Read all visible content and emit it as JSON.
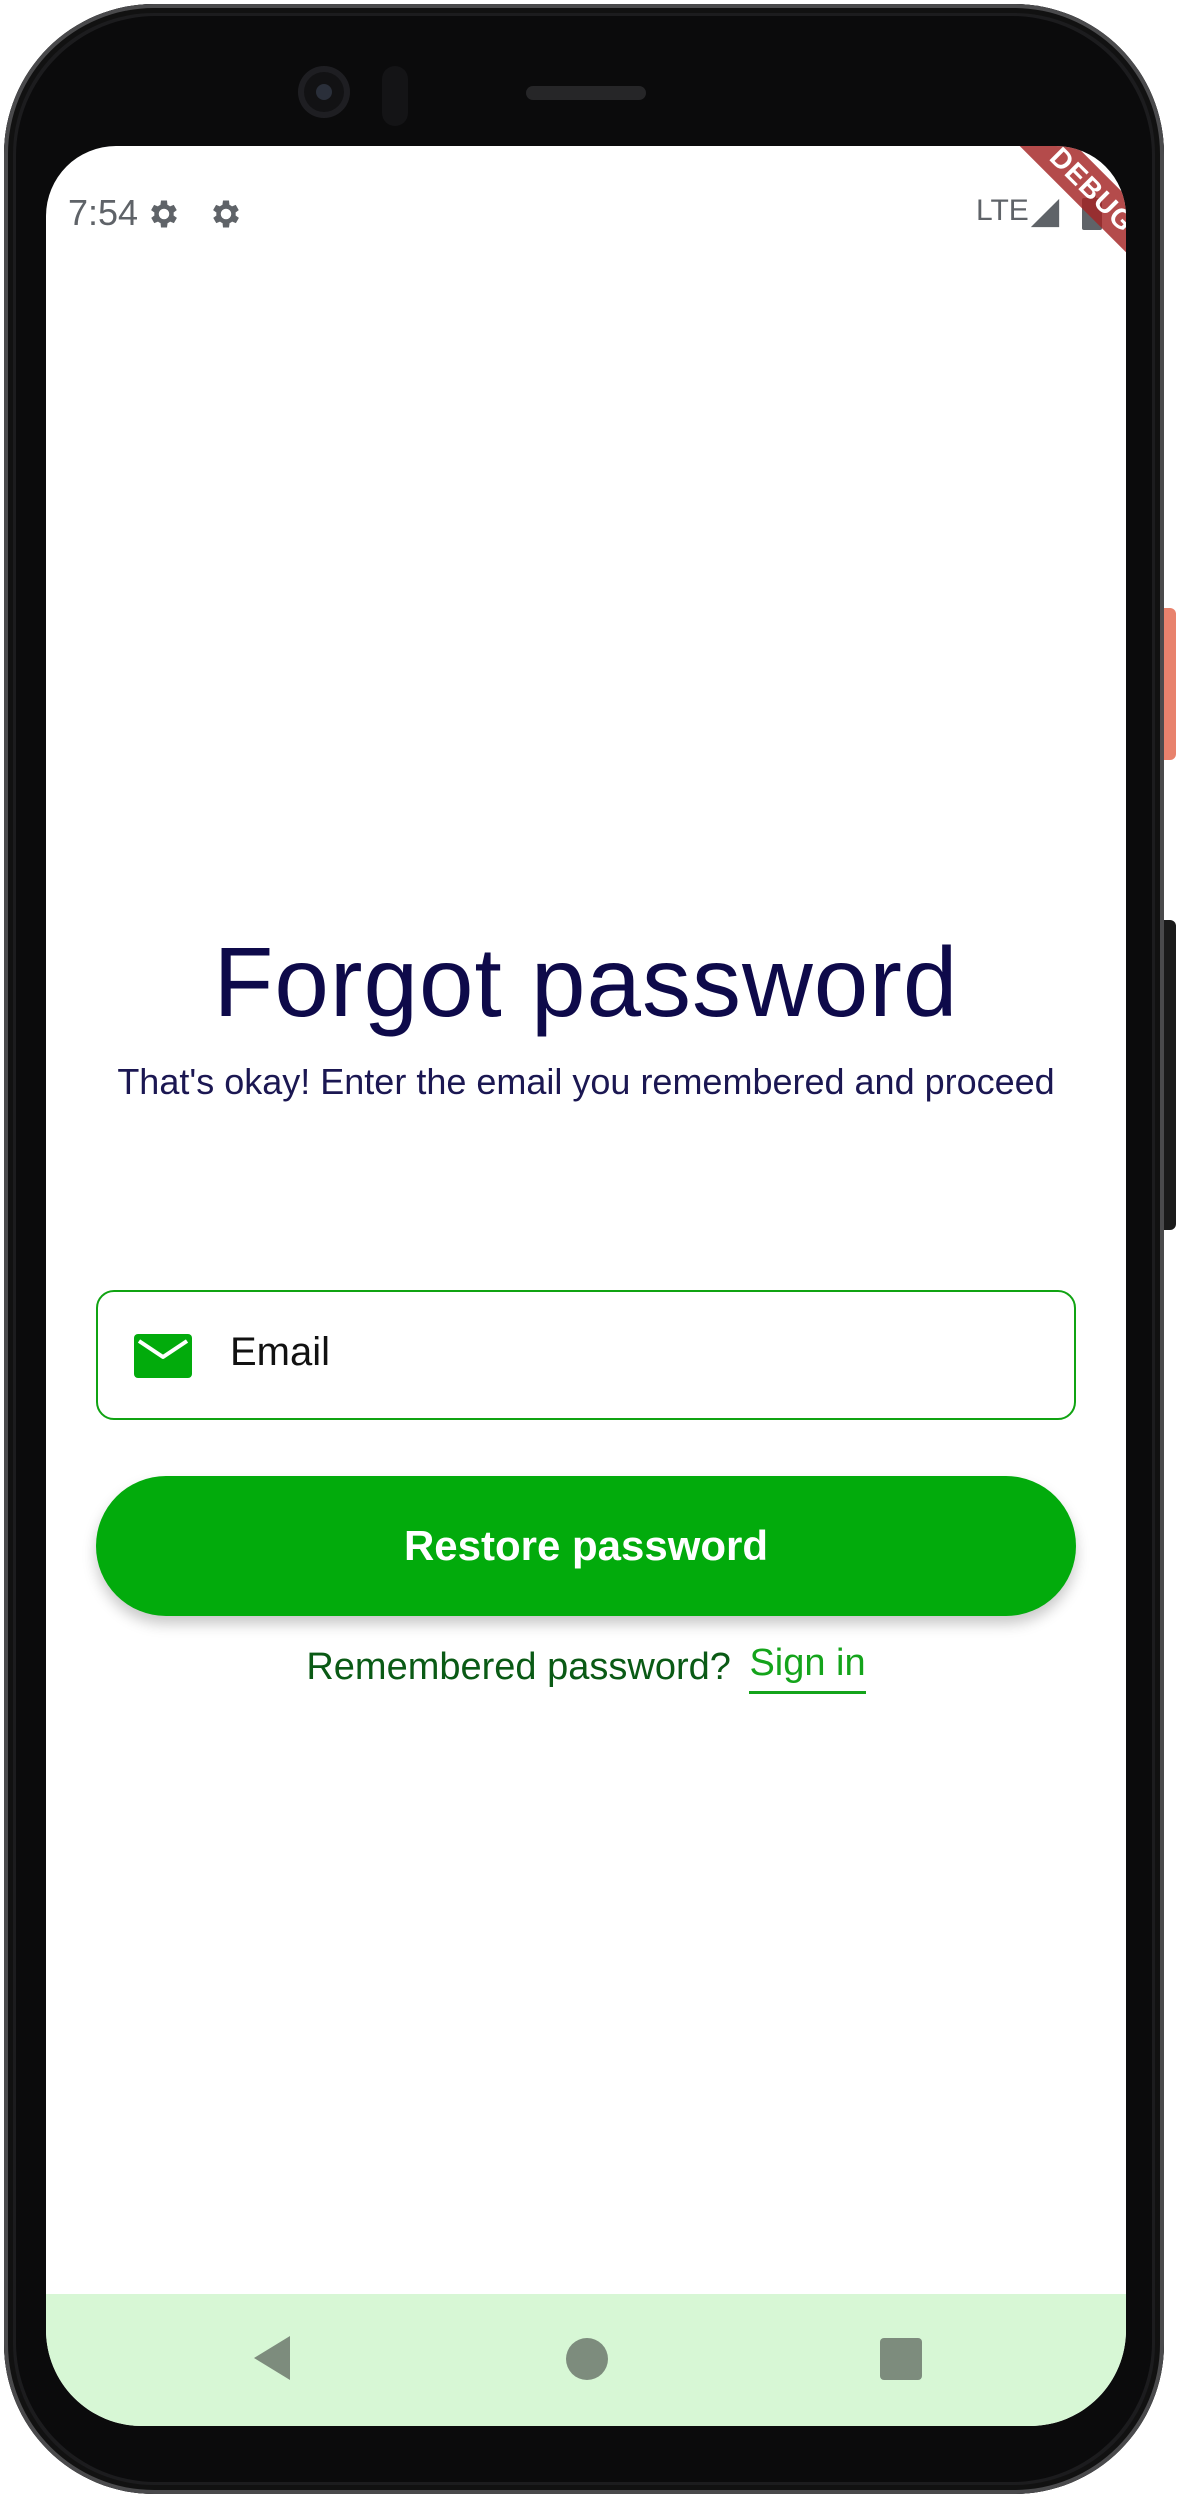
{
  "status_bar": {
    "time": "7:54",
    "network": "LTE",
    "icons": [
      "gear-icon",
      "gear-icon",
      "signal-icon",
      "battery-icon"
    ],
    "debug_banner": "DEBUG"
  },
  "forgot_password": {
    "title": "Forgot password",
    "subtitle": "That's okay! Enter the email you remembered and proceed",
    "email_field": {
      "placeholder": "Email",
      "icon": "mail-icon"
    },
    "restore_button": "Restore password",
    "remembered_text": "Remembered password?",
    "sign_in_link": "Sign in"
  },
  "nav_bar": {
    "items": [
      "back-icon",
      "home-icon",
      "recents-icon"
    ]
  },
  "colors": {
    "primary_green": "#02ab0c",
    "title_navy": "#0e0a4a",
    "link_green": "#14a41b",
    "nav_background": "#d7f7d5",
    "debug_red": "#a42323"
  }
}
